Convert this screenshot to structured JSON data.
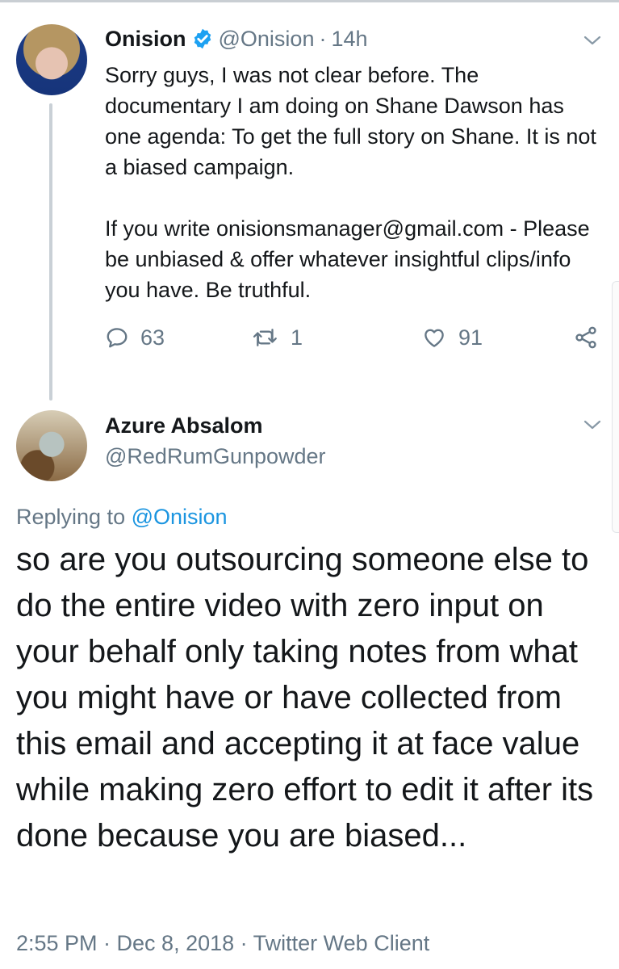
{
  "original_tweet": {
    "display_name": "Onision",
    "handle": "@Onision",
    "separator": "·",
    "time": "14h",
    "paragraphs": [
      "Sorry guys, I was not clear before. The documentary I am doing on Shane Dawson has one agenda: To get the full story on Shane. It is not a biased campaign.",
      "If you write onisionsmanager@gmail.com - Please be unbiased & offer whatever insightful clips/info you have. Be truthful."
    ],
    "reply_count": "63",
    "retweet_count": "1",
    "like_count": "91"
  },
  "reply_tweet": {
    "display_name": "Azure Absalom",
    "handle": "@RedRumGunpowder",
    "replying_prefix": "Replying to",
    "replying_to": "@Onision",
    "text": "so are you outsourcing someone else to do the entire video with zero input on your behalf only taking notes from what you might have or have collected from this email and accepting it at face value while making zero effort to edit it after its done because you are biased...",
    "timestamp": "2:55 PM · Dec 8, 2018 · Twitter Web Client"
  },
  "colors": {
    "text": "#14171a",
    "secondary": "#657786",
    "link": "#1b95e0",
    "verified": "#1da1f2"
  },
  "icons": {
    "verified": "verified-badge-icon",
    "more": "chevron-down-icon",
    "reply": "comment-icon",
    "retweet": "retweet-icon",
    "like": "heart-icon",
    "share": "share-icon"
  }
}
